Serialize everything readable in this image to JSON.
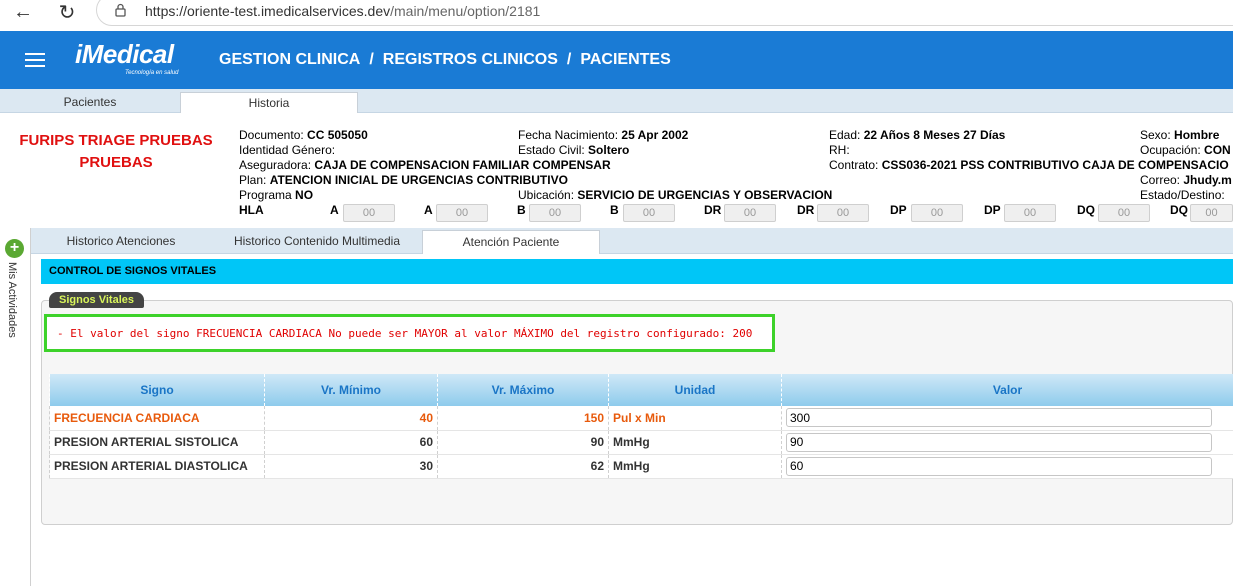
{
  "browser": {
    "url_host": "https://oriente-test.imedicalservices.dev",
    "url_path": "/main/menu/option/2181"
  },
  "header": {
    "logo_text": "iMedical",
    "logo_tagline": "Tecnología en salud",
    "breadcrumb": [
      "GESTION CLINICA",
      "REGISTROS CLINICOS",
      "PACIENTES"
    ],
    "separator": "/",
    "accent_color": "#1a7bd5"
  },
  "top_tabs": [
    {
      "label": "Pacientes"
    },
    {
      "label": "Historia"
    }
  ],
  "patient": {
    "name_line1": "FURIPS TRIAGE PRUEBAS",
    "name_line2": "PRUEBAS",
    "documento_label": "Documento:",
    "documento": "CC 505050",
    "genero_label": "Identidad Género:",
    "aseguradora_label": "Aseguradora:",
    "aseguradora": "CAJA DE COMPENSACION FAMILIAR COMPENSAR",
    "plan_label": "Plan:",
    "plan": "ATENCION INICIAL DE URGENCIAS CONTRIBUTIVO",
    "programa_label": "Programa",
    "programa": "NO",
    "nacimiento_label": "Fecha Nacimiento:",
    "nacimiento": "25 Apr 2002",
    "civil_label": "Estado Civil:",
    "civil": "Soltero",
    "ubicacion_label": "Ubicación:",
    "ubicacion": "SERVICIO DE URGENCIAS Y OBSERVACION",
    "edad_label": "Edad:",
    "edad": "22 Años 8 Meses 27 Días",
    "rh_label": "RH:",
    "contrato_label": "Contrato:",
    "contrato": "CSS036-2021 PSS CONTRIBUTIVO CAJA DE COMPENSACIO",
    "sexo_label": "Sexo:",
    "sexo": "Hombre",
    "ocupacion_label": "Ocupación:",
    "ocupacion": "CON",
    "correo_label": "Correo:",
    "correo": "Jhudy.m",
    "destino_label": "Estado/Destino:",
    "hla_label": "HLA",
    "hla": [
      {
        "label": "A",
        "value": "00"
      },
      {
        "label": "A",
        "value": "00"
      },
      {
        "label": "B",
        "value": "00"
      },
      {
        "label": "B",
        "value": "00"
      },
      {
        "label": "DR",
        "value": "00"
      },
      {
        "label": "DR",
        "value": "00"
      },
      {
        "label": "DP",
        "value": "00"
      },
      {
        "label": "DP",
        "value": "00"
      },
      {
        "label": "DQ",
        "value": "00"
      },
      {
        "label": "DQ",
        "value": "00"
      }
    ]
  },
  "sidebar": {
    "label": "Mis Actividades",
    "plus": "+"
  },
  "sub_tabs": [
    {
      "label": "Historico Atenciones"
    },
    {
      "label": "Historico Contenido Multimedia"
    },
    {
      "label": "Atención Paciente"
    }
  ],
  "section": {
    "title": "CONTROL DE SIGNOS VITALES",
    "legend": "Signos Vitales",
    "error": "- El valor del signo FRECUENCIA CARDIACA No puede ser MAYOR al valor MÁXIMO del registro configurado: 200"
  },
  "table": {
    "headers": [
      "Signo",
      "Vr. Mínimo",
      "Vr. Máximo",
      "Unidad",
      "Valor"
    ],
    "rows": [
      {
        "signo": "FRECUENCIA CARDIACA",
        "min": "40",
        "max": "150",
        "unidad": "Pul x Min",
        "valor": "300"
      },
      {
        "signo": "PRESION ARTERIAL SISTOLICA",
        "min": "60",
        "max": "90",
        "unidad": "MmHg",
        "valor": "90"
      },
      {
        "signo": "PRESION ARTERIAL DIASTOLICA",
        "min": "30",
        "max": "62",
        "unidad": "MmHg",
        "valor": "60"
      }
    ]
  }
}
